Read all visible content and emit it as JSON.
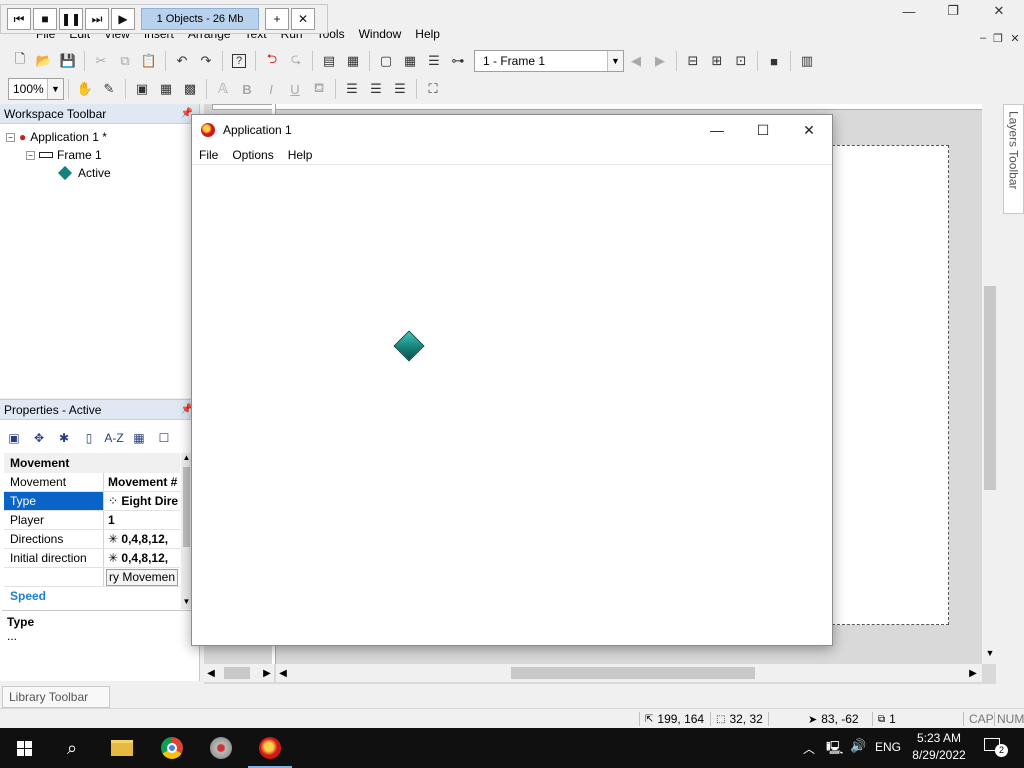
{
  "main_menu": [
    "File",
    "Edit",
    "View",
    "Insert",
    "Arrange",
    "Text",
    "Run",
    "Tools",
    "Window",
    "Help"
  ],
  "playback": {
    "status": "1 Objects - 26 Mb"
  },
  "toolbar": {
    "frame_select": "1 - Frame 1",
    "zoom": "100%",
    "bold": "B",
    "italic": "I",
    "underline": "U"
  },
  "workspace": {
    "title": "Workspace Toolbar",
    "tree": [
      {
        "label": "Application 1 *",
        "icon": "app-icon"
      },
      {
        "label": "Frame 1",
        "icon": "frame-icon"
      },
      {
        "label": "Active",
        "icon": "active-object-icon"
      }
    ]
  },
  "properties": {
    "title": "Properties - Active",
    "group_movement": "Movement",
    "rows": [
      {
        "key": "Movement",
        "value": "Movement #"
      },
      {
        "key": "Type",
        "value": "Eight Dire"
      },
      {
        "key": "Player",
        "value": "1"
      },
      {
        "key": "Directions",
        "value": "0,4,8,12,"
      },
      {
        "key": "Initial direction",
        "value": "0,4,8,12,"
      },
      {
        "key": "",
        "value": "ry Movemen"
      }
    ],
    "group_speed": "Speed",
    "desc_title": "Type",
    "desc_text": "..."
  },
  "library_tab": "Library Toolbar",
  "layers_tab": "Layers Toolbar",
  "app_window": {
    "title": "Application 1",
    "menu": [
      "File",
      "Options",
      "Help"
    ]
  },
  "statusbar": {
    "mouse_pos": "199, 164",
    "size": "32, 32",
    "hotspot": "83, -62",
    "layer": "1",
    "caps": "CAP",
    "num": "NUM"
  },
  "taskbar": {
    "lang": "ENG",
    "time": "5:23 AM",
    "date": "8/29/2022",
    "notifications": "2"
  },
  "colors": {
    "selection": "#0a64c8",
    "selection_text": "#ffffff",
    "group_link": "#1f7fd6",
    "active_diamond": "#17807a"
  }
}
